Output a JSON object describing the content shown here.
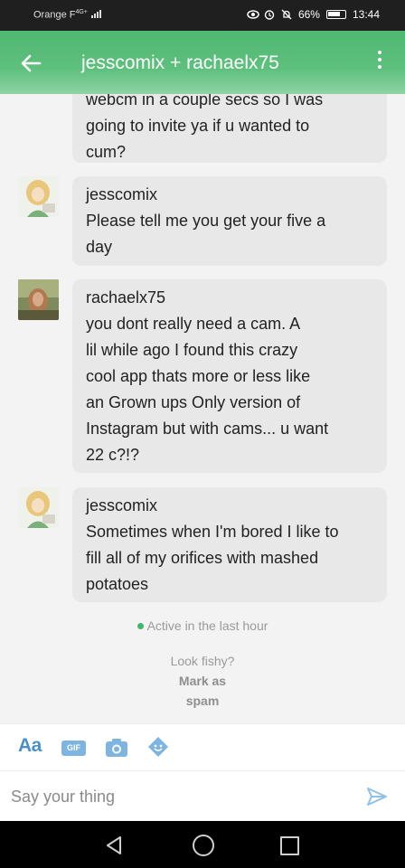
{
  "status_bar": {
    "carrier": "Orange F",
    "network": "4G+",
    "battery": "66%",
    "time": "13:44"
  },
  "header": {
    "title": "jesscomix + rachaelx75"
  },
  "messages": [
    {
      "sender": "",
      "lines": [
        "webcm in a couple secs so I was",
        "going to invite ya if u wanted to",
        "cum?"
      ]
    },
    {
      "sender": "jesscomix",
      "lines": [
        "Please tell me you get your five a",
        "day"
      ]
    },
    {
      "sender": "rachaelx75",
      "lines": [
        "you dont really need a cam. A",
        "lil while ago I found this crazy",
        "cool app thats more or less like",
        "an Grown ups Only version of",
        "Instagram but with cams... u want",
        "22 c?!?"
      ]
    },
    {
      "sender": "jesscomix",
      "lines": [
        "Sometimes when I'm bored I like to",
        "fill all of my orifices with mashed",
        "potatoes"
      ]
    }
  ],
  "activity": {
    "status": "Active in the last hour"
  },
  "report": {
    "prompt": "Look fishy?",
    "action_line1": "Mark as",
    "action_line2": "spam"
  },
  "toolbar": {
    "text_style_label": "Aa",
    "gif_label": "GIF",
    "camera_icon": "camera-icon",
    "sticker_icon": "sticker-icon"
  },
  "compose": {
    "placeholder": "Say your thing"
  },
  "colors": {
    "header_green": "#5ec07d",
    "accent_blue": "#4a90c8",
    "active_green": "#3fb96b",
    "bubble_gray": "#e8e8e8"
  }
}
